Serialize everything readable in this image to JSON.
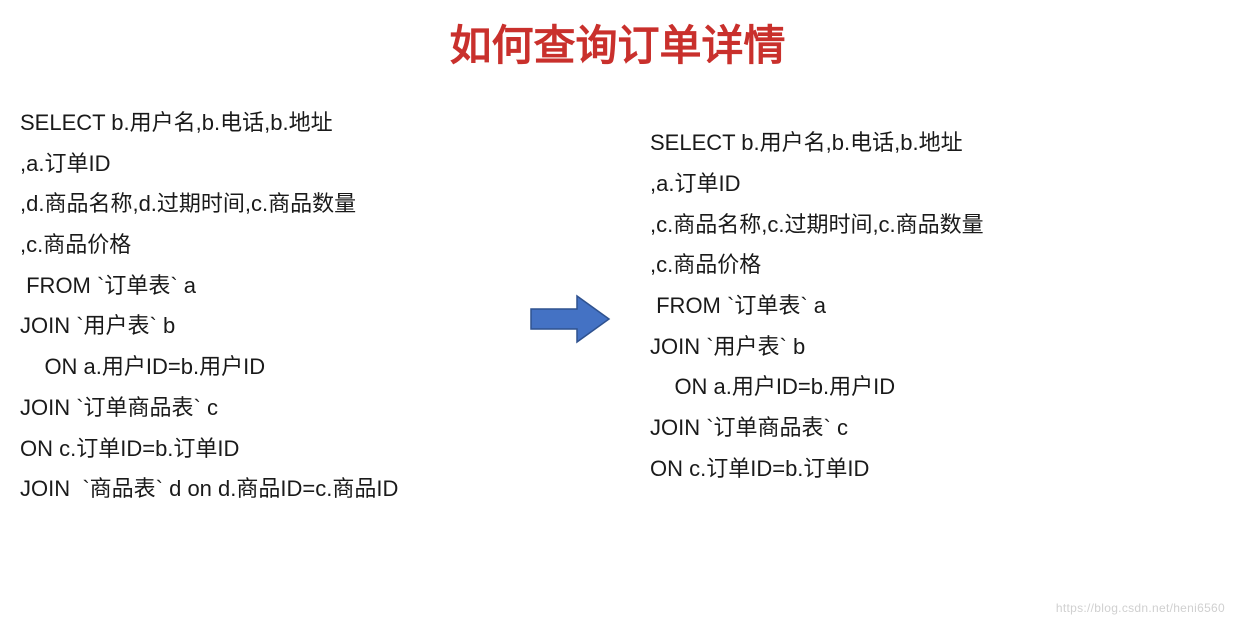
{
  "title": "如何查询订单详情",
  "left_code": "SELECT b.用户名,b.电话,b.地址\n,a.订单ID\n,d.商品名称,d.过期时间,c.商品数量\n,c.商品价格\n FROM `订单表` a\nJOIN `用户表` b\n    ON a.用户ID=b.用户ID\nJOIN `订单商品表` c\nON c.订单ID=b.订单ID\nJOIN  `商品表` d on d.商品ID=c.商品ID",
  "right_code": "SELECT b.用户名,b.电话,b.地址\n,a.订单ID\n,c.商品名称,c.过期时间,c.商品数量\n,c.商品价格\n FROM `订单表` a\nJOIN `用户表` b\n    ON a.用户ID=b.用户ID\nJOIN `订单商品表` c\nON c.订单ID=b.订单ID",
  "watermark": "https://blog.csdn.net/heni6560",
  "colors": {
    "title": "#c9302c",
    "text": "#1a1a1a",
    "arrow_fill": "#4472c4",
    "arrow_stroke": "#2f528f"
  }
}
